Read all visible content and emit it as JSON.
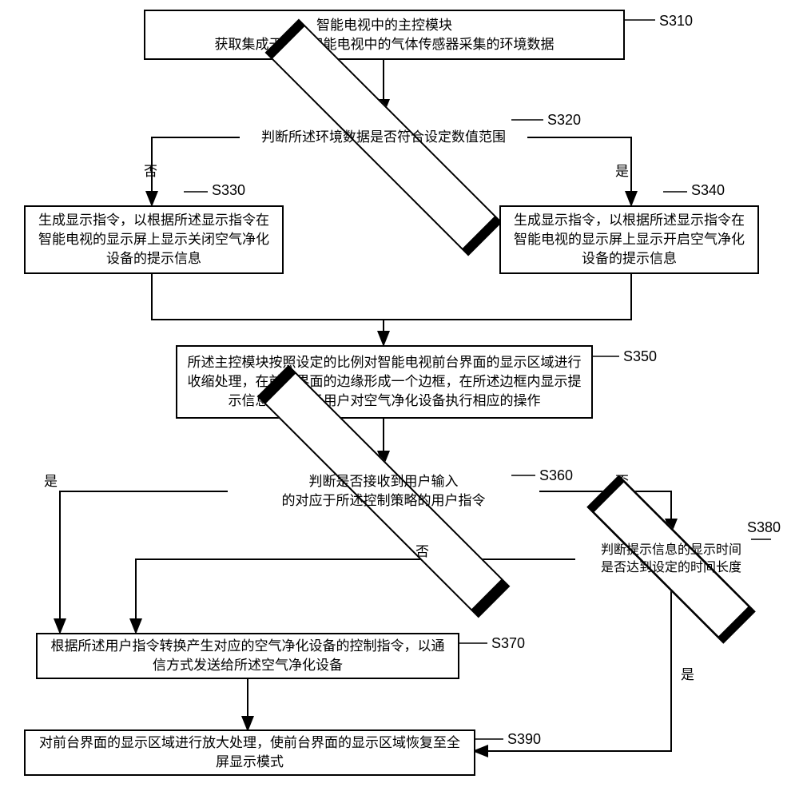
{
  "flowchart": {
    "steps": {
      "s310": {
        "id": "S310",
        "text": "智能电视中的主控模块\n获取集成于所述智能电视中的气体传感器采集的环境数据"
      },
      "s320": {
        "id": "S320",
        "text": "判断所述环境数据是否符合设定数值范围"
      },
      "s330": {
        "id": "S330",
        "text": "生成显示指令，以根据所述显示指令在智能电视的显示屏上显示关闭空气净化设备的提示信息"
      },
      "s340": {
        "id": "S340",
        "text": "生成显示指令，以根据所述显示指令在智能电视的显示屏上显示开启空气净化设备的提示信息"
      },
      "s350": {
        "id": "S350",
        "text": "所述主控模块按照设定的比例对智能电视前台界面的显示区域进行收缩处理，在前台界面的边缘形成一个边框，在所述边框内显示提示信息，以提示用户对空气净化设备执行相应的操作"
      },
      "s360": {
        "id": "S360",
        "text": "判断是否接收到用户输入\n的对应于所述控制策略的用户指令"
      },
      "s370": {
        "id": "S370",
        "text": "根据所述用户指令转换产生对应的空气净化设备的控制指令，以通信方式发送给所述空气净化设备"
      },
      "s380": {
        "id": "S380",
        "text": "判断提示信息的显示时间\n是否达到设定的时间长度"
      },
      "s390": {
        "id": "S390",
        "text": "对前台界面的显示区域进行放大处理，使前台界面的显示区域恢复至全屏显示模式"
      }
    },
    "branches": {
      "yes": "是",
      "no": "否"
    }
  }
}
